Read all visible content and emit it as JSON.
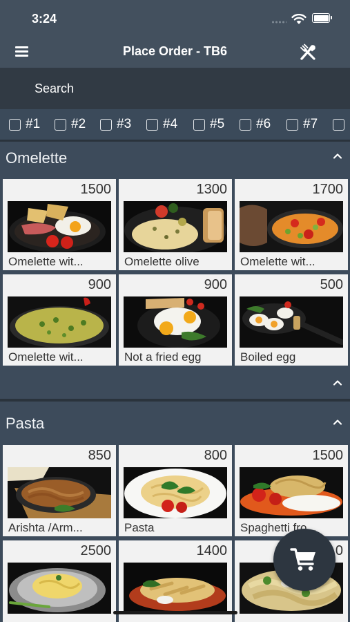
{
  "status": {
    "time": "3:24"
  },
  "nav": {
    "title": "Place Order - TB6",
    "menu_icon": "hamburger-menu-icon",
    "action_icon": "fork-knife-icon"
  },
  "search": {
    "placeholder": "Search",
    "value": ""
  },
  "tables": [
    "#1",
    "#2",
    "#3",
    "#4",
    "#5",
    "#6",
    "#7",
    ""
  ],
  "sections": [
    {
      "name": "Omelette",
      "items": [
        {
          "price": "1500",
          "name": "Omelette wit..."
        },
        {
          "price": "1300",
          "name": "Omelette olive"
        },
        {
          "price": "1700",
          "name": "Omelette wit..."
        },
        {
          "price": "900",
          "name": "Omelette wit..."
        },
        {
          "price": "900",
          "name": "Not a fried egg"
        },
        {
          "price": "500",
          "name": "Boiled egg"
        }
      ]
    },
    {
      "name": "Pasta",
      "items": [
        {
          "price": "850",
          "name": "Arishta /Arm..."
        },
        {
          "price": "800",
          "name": "Pasta"
        },
        {
          "price": "1500",
          "name": "Spaghetti fro..."
        },
        {
          "price": "2500",
          "name": ""
        },
        {
          "price": "1400",
          "name": ""
        },
        {
          "price": "0",
          "name": ""
        }
      ]
    }
  ],
  "cart": {
    "icon": "cart-icon"
  },
  "colors": {
    "background": "#3b4a5a",
    "header": "#43505e",
    "search": "#313a44",
    "card": "#f2f2f2",
    "fab": "#2d3640"
  }
}
